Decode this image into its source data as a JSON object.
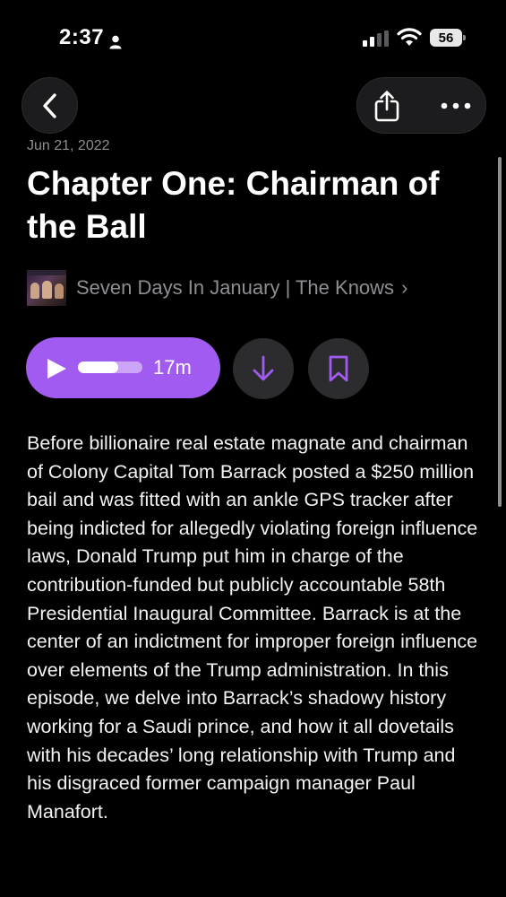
{
  "status_bar": {
    "time": "2:37",
    "battery_level": "56",
    "icons": [
      "person-icon",
      "signal-icon",
      "wifi-icon",
      "battery-icon"
    ]
  },
  "nav": {
    "back_icon": "chevron-left-icon",
    "share_icon": "share-icon",
    "more_icon": "ellipsis-icon"
  },
  "episode": {
    "date": "Jun 21, 2022",
    "title": "Chapter One: Chairman of the Ball",
    "show_name": "Seven Days In January | The Knows",
    "show_chevron": "›",
    "artwork_icon": "podcast-artwork"
  },
  "player": {
    "duration": "17m",
    "progress": 0.62,
    "play_icon": "play-icon",
    "download_icon": "download-arrow-icon",
    "bookmark_icon": "bookmark-icon",
    "accent_color": "#a25bf0"
  },
  "description": "Before billionaire real estate magnate and chairman of Colony Capital Tom Barrack posted a $250 million bail and was fitted with an ankle GPS tracker after being indicted for allegedly violating foreign influence laws, Donald Trump put him in charge of the contribution-funded but publicly accountable 58th Presidential Inaugural Committee. Barrack is at the center of an indictment for improper foreign influence over elements of the Trump administration. In this episode, we delve into Barrack’s shadowy history working for a Saudi prince, and how it all dovetails with his decades’ long relationship with Trump and his disgraced former campaign manager Paul Manafort."
}
